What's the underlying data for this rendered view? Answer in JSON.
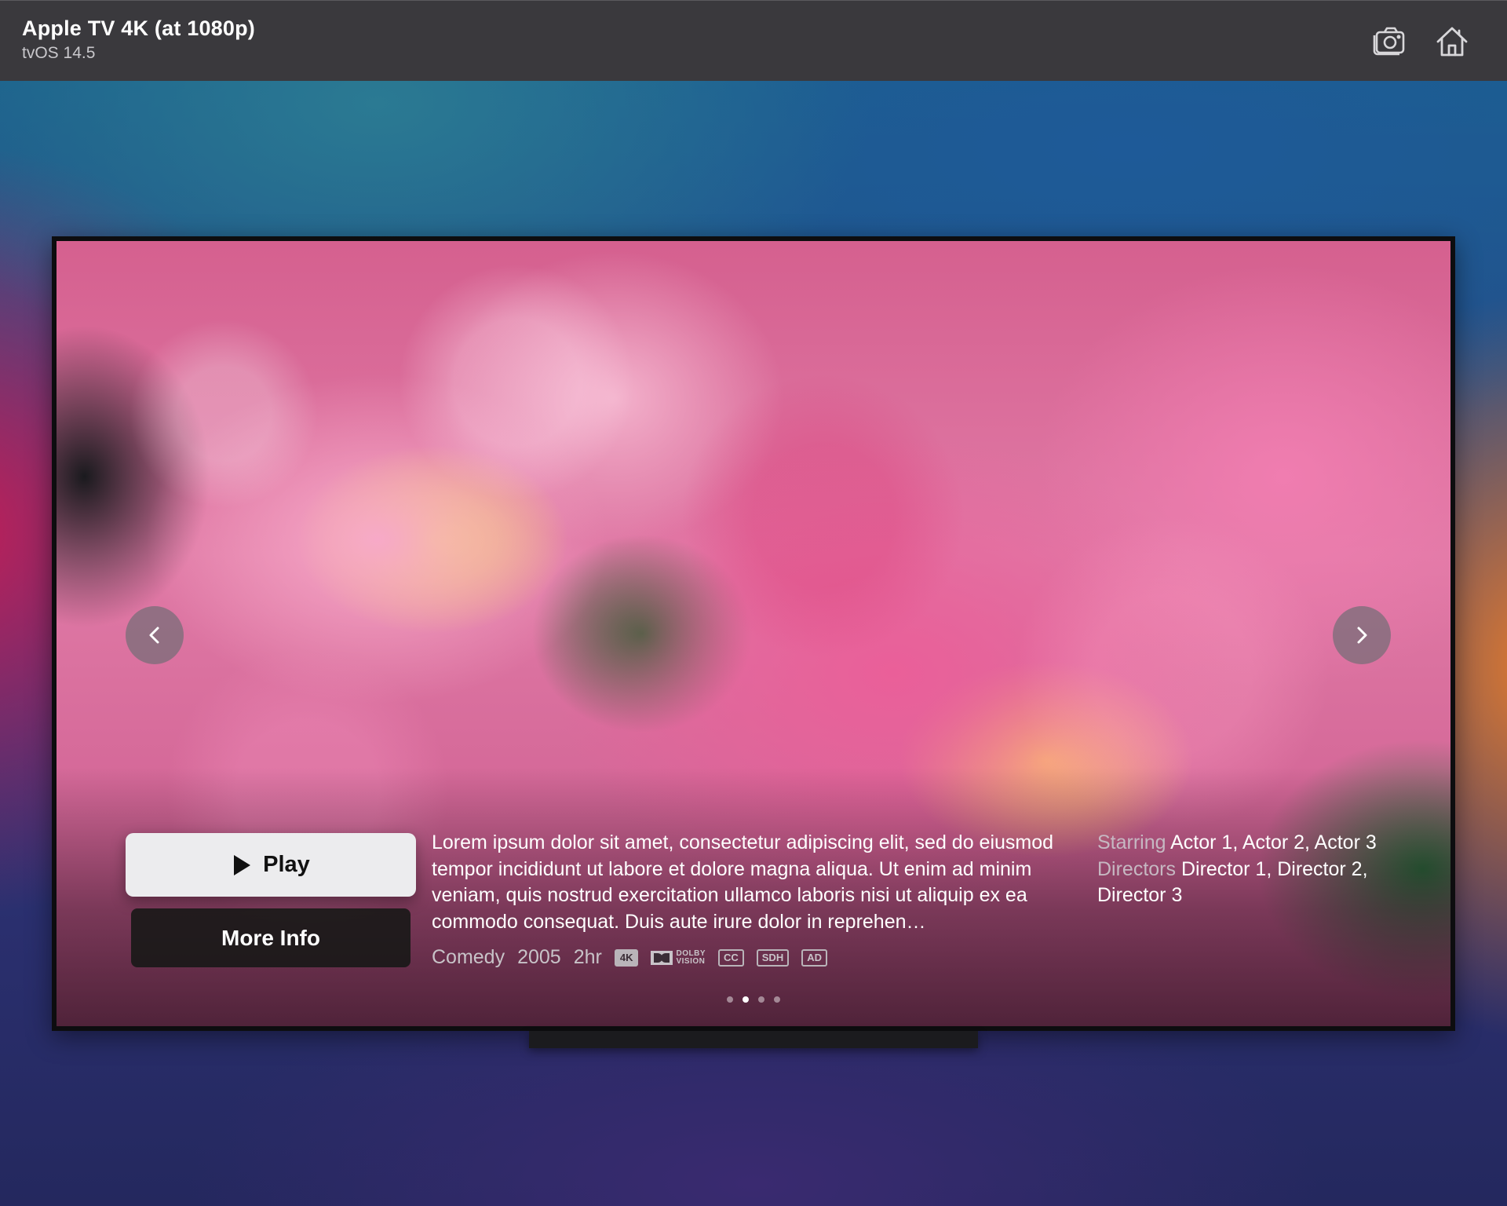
{
  "window": {
    "device_name": "Apple TV 4K (at 1080p)",
    "os_version": "tvOS 14.5",
    "toolbar": [
      {
        "name": "screenshot-button",
        "icon": "camera-icon"
      },
      {
        "name": "home-button",
        "icon": "home-icon"
      }
    ]
  },
  "hero": {
    "background_image": "pink-peony-flowers",
    "play_label": "Play",
    "more_info_label": "More Info",
    "description": "Lorem ipsum dolor sit amet, consectetur adipiscing elit, sed do eiusmod tempor incididunt ut labore et dolore magna aliqua. Ut enim ad minim veniam, quis nostrud exercitation ullamco laboris nisi ut aliquip ex ea commodo consequat. Duis aute irure dolor in reprehen…",
    "meta": {
      "genre": "Comedy",
      "year": "2005",
      "duration": "2hr",
      "badges": [
        "4K",
        "CC",
        "SDH",
        "AD"
      ],
      "dolby_top": "DOLBY",
      "dolby_bottom": "VISION"
    },
    "credits": {
      "starring_label": "Starring",
      "starring_value": "Actor 1, Actor 2, Actor 3",
      "directors_label": "Directors",
      "directors_value": "Director 1, Director 2, Director 3"
    },
    "page_dots": {
      "count": 4,
      "active_index": 1
    }
  },
  "colors": {
    "titlebar": "#3a393d",
    "play_button": "#ececee",
    "more_info_button": "#161816"
  }
}
